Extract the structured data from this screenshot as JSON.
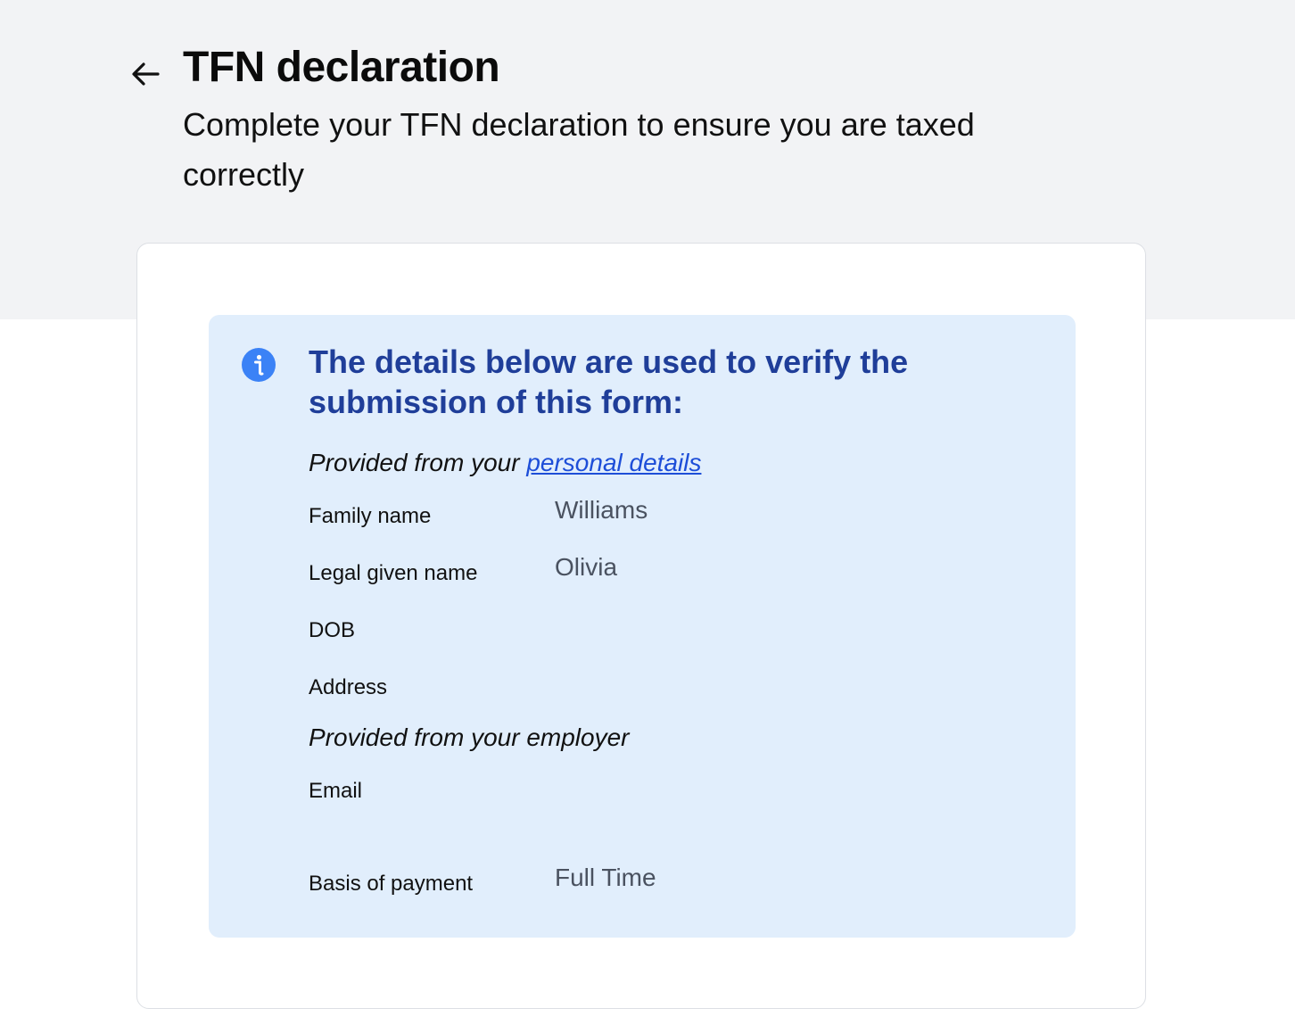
{
  "header": {
    "title": "TFN declaration",
    "subtitle": "Complete your TFN declaration to ensure you are taxed correctly"
  },
  "info": {
    "heading": "The details below are used to verify the submission of this form:",
    "personal_prefix": "Provided from your ",
    "personal_link": "personal details",
    "employer_label": "Provided from your employer",
    "icon_color": "#3b82f6",
    "heading_color": "#1f3e99",
    "background": "#e1eefc"
  },
  "personal_rows": [
    {
      "label": "Family name",
      "value": "Williams"
    },
    {
      "label": "Legal given name",
      "value": "Olivia"
    },
    {
      "label": "DOB",
      "value": ""
    },
    {
      "label": "Address",
      "value": ""
    }
  ],
  "employer_rows": [
    {
      "label": "Email",
      "value": ""
    },
    {
      "label": "Basis of payment",
      "value": "Full Time"
    }
  ]
}
